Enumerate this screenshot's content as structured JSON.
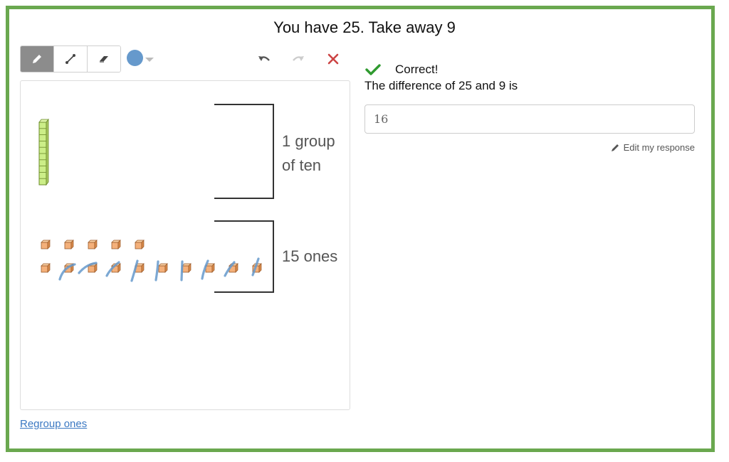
{
  "question": {
    "title": "You have 25. Take away 9"
  },
  "toolbar": {
    "tools": [
      {
        "name": "pencil-icon",
        "active": true
      },
      {
        "name": "line-icon",
        "active": false
      },
      {
        "name": "eraser-icon",
        "active": false
      }
    ],
    "pen_color": "#6699cc"
  },
  "canvas": {
    "group_ten_label": "1 group",
    "group_ten_label_2": "of ten",
    "ones_label": "15 ones"
  },
  "links": {
    "regroup": "Regroup ones"
  },
  "feedback": {
    "status": "Correct!",
    "prompt": "The difference of 25 and 9 is"
  },
  "response": {
    "value": "16",
    "edit_label": "Edit my response"
  }
}
